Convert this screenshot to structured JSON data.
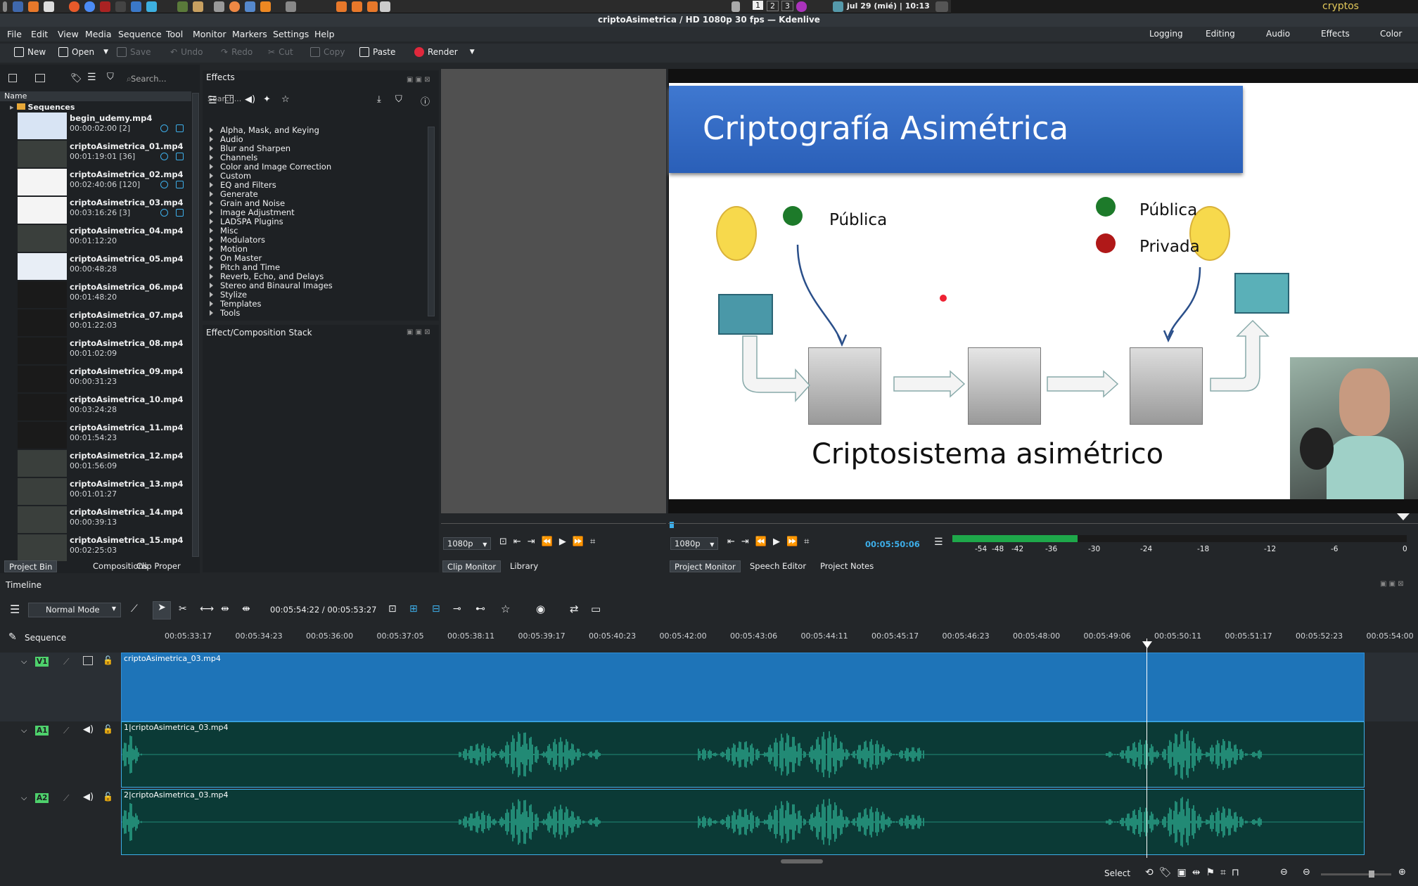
{
  "system": {
    "workspaces": [
      "1",
      "2",
      "3"
    ],
    "clock": "jul 29 (mié) | 10:13",
    "hostname": "cryptos"
  },
  "window": {
    "title": "criptoAsimetrica / HD 1080p 30 fps — Kdenlive"
  },
  "menu": [
    "File",
    "Edit",
    "View",
    "Media",
    "Sequence",
    "Tool",
    "Monitor",
    "Markers",
    "Settings",
    "Help"
  ],
  "layouts": [
    "Logging",
    "Editing",
    "Audio",
    "Effects",
    "Color"
  ],
  "toolbar": {
    "new": "New",
    "open": "Open",
    "save": "Save",
    "undo": "Undo",
    "redo": "Redo",
    "cut": "Cut",
    "copy": "Copy",
    "paste": "Paste",
    "render": "Render"
  },
  "project_bin": {
    "search_placeholder": "Search...",
    "column_header": "Name",
    "folder": "Sequences",
    "clips": [
      {
        "name": "begin_udemy.mp4",
        "duration": "00:00:02:00 [2]",
        "audio": true,
        "video": true
      },
      {
        "name": "criptoAsimetrica_01.mp4",
        "duration": "00:01:19:01 [36]",
        "audio": true,
        "video": true
      },
      {
        "name": "criptoAsimetrica_02.mp4",
        "duration": "00:02:40:06 [120]",
        "audio": true,
        "video": true
      },
      {
        "name": "criptoAsimetrica_03.mp4",
        "duration": "00:03:16:26 [3]",
        "audio": true,
        "video": true
      },
      {
        "name": "criptoAsimetrica_04.mp4",
        "duration": "00:01:12:20"
      },
      {
        "name": "criptoAsimetrica_05.mp4",
        "duration": "00:00:48:28"
      },
      {
        "name": "criptoAsimetrica_06.mp4",
        "duration": "00:01:48:20"
      },
      {
        "name": "criptoAsimetrica_07.mp4",
        "duration": "00:01:22:03"
      },
      {
        "name": "criptoAsimetrica_08.mp4",
        "duration": "00:01:02:09"
      },
      {
        "name": "criptoAsimetrica_09.mp4",
        "duration": "00:00:31:23"
      },
      {
        "name": "criptoAsimetrica_10.mp4",
        "duration": "00:03:24:28"
      },
      {
        "name": "criptoAsimetrica_11.mp4",
        "duration": "00:01:54:23"
      },
      {
        "name": "criptoAsimetrica_12.mp4",
        "duration": "00:01:56:09"
      },
      {
        "name": "criptoAsimetrica_13.mp4",
        "duration": "00:01:01:27"
      },
      {
        "name": "criptoAsimetrica_14.mp4",
        "duration": "00:00:39:13"
      },
      {
        "name": "criptoAsimetrica_15.mp4",
        "duration": "00:02:25:03"
      }
    ],
    "tabs": [
      "Project Bin",
      "Compositions",
      "Clip Proper"
    ]
  },
  "effects": {
    "title": "Effects",
    "search_placeholder": "Search...",
    "categories": [
      "Alpha, Mask, and Keying",
      "Audio",
      "Blur and Sharpen",
      "Channels",
      "Color and Image Correction",
      "Custom",
      "EQ and Filters",
      "Generate",
      "Grain and Noise",
      "Image Adjustment",
      "LADSPA Plugins",
      "Misc",
      "Modulators",
      "Motion",
      "On Master",
      "Pitch and Time",
      "Reverb, Echo, and Delays",
      "Stereo and Binaural Images",
      "Stylize",
      "Templates",
      "Tools"
    ],
    "stack_title": "Effect/Composition Stack"
  },
  "clip_monitor": {
    "resolution": "1080p",
    "tabs": [
      "Clip Monitor",
      "Library"
    ]
  },
  "project_monitor": {
    "resolution": "1080p",
    "timecode": "00:05:50:06",
    "vu_labels": [
      "-54",
      "-48",
      "-42",
      "-36",
      "-30",
      "-24",
      "-18",
      "-12",
      "-6",
      "0"
    ],
    "tabs": [
      "Project Monitor",
      "Speech Editor",
      "Project Notes"
    ],
    "slide": {
      "title": "Criptografía Asimétrica",
      "left_key": "Pública",
      "right_key_public": "Pública",
      "right_key_private": "Privada",
      "caption": "Criptosistema asimétrico"
    }
  },
  "timeline": {
    "title": "Timeline",
    "mode": "Normal Mode",
    "position": "00:05:54:22 / 00:05:53:27",
    "sequence": "Sequence",
    "ruler": [
      "00:05:33:17",
      "00:05:34:23",
      "00:05:36:00",
      "00:05:37:05",
      "00:05:38:11",
      "00:05:39:17",
      "00:05:40:23",
      "00:05:42:00",
      "00:05:43:06",
      "00:05:44:11",
      "00:05:45:17",
      "00:05:46:23",
      "00:05:48:00",
      "00:05:49:06",
      "00:05:50:11",
      "00:05:51:17",
      "00:05:52:23",
      "00:05:54:00"
    ],
    "tracks": [
      {
        "id": "V1",
        "clip": "criptoAsimetrica_03.mp4"
      },
      {
        "id": "A1",
        "clip": "1|criptoAsimetrica_03.mp4"
      },
      {
        "id": "A2",
        "clip": "2|criptoAsimetrica_03.mp4"
      }
    ]
  },
  "status": {
    "tool": "Select"
  },
  "colors": {
    "accent": "#3daee9",
    "track_label": "#4ed16c",
    "video_clip": "#1e74b8",
    "audio_wave": "#2aa58a"
  }
}
